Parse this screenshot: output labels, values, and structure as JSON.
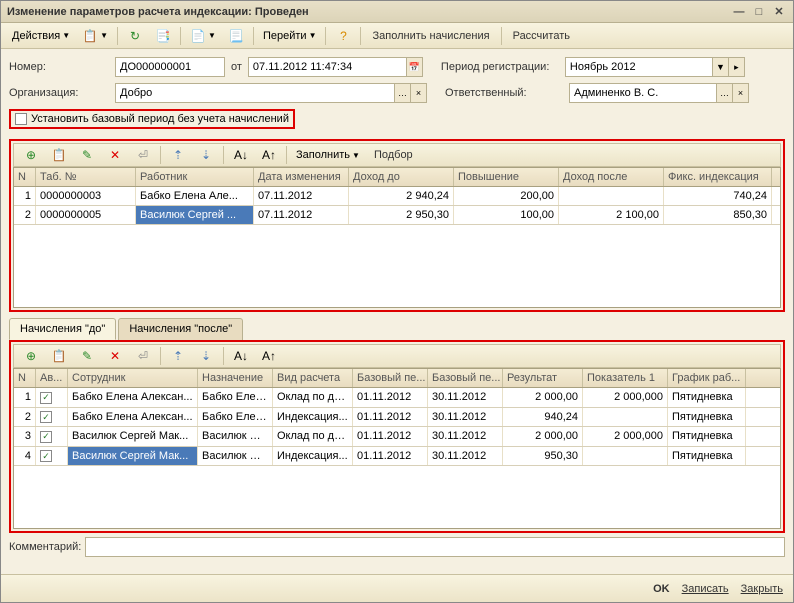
{
  "window": {
    "title": "Изменение параметров расчета индексации: Проведен"
  },
  "toolbar": {
    "actions": "Действия",
    "goto": "Перейти",
    "fill_accruals": "Заполнить начисления",
    "calculate": "Рассчитать"
  },
  "form": {
    "number_label": "Номер:",
    "number": "ДО000000001",
    "from_label": "от",
    "date": "07.11.2012 11:47:34",
    "period_label": "Период регистрации:",
    "period": "Ноябрь 2012",
    "org_label": "Организация:",
    "org": "Добро",
    "resp_label": "Ответственный:",
    "resp": "Админенко В. С.",
    "base_period": "Установить базовый период без учета начислений"
  },
  "grid1_toolbar": {
    "fill": "Заполнить",
    "select": "Подбор"
  },
  "grid1": {
    "headers": {
      "n": "N",
      "tab": "Таб. №",
      "worker": "Работник",
      "date": "Дата изменения",
      "income_before": "Доход до",
      "raise": "Повышение",
      "income_after": "Доход после",
      "fixed": "Фикс. индексация"
    },
    "rows": [
      {
        "n": "1",
        "tab": "0000000003",
        "worker": "Бабко Елена Але...",
        "date": "07.11.2012",
        "income_before": "2 940,24",
        "raise": "200,00",
        "income_after": "",
        "fixed": "740,24"
      },
      {
        "n": "2",
        "tab": "0000000005",
        "worker": "Василюк Сергей ...",
        "date": "07.11.2012",
        "income_before": "2 950,30",
        "raise": "100,00",
        "income_after": "2 100,00",
        "fixed": "850,30"
      }
    ]
  },
  "tabs": {
    "before": "Начисления \"до\"",
    "after": "Начисления \"после\""
  },
  "grid2": {
    "headers": {
      "n": "N",
      "av": "Ав...",
      "employee": "Сотрудник",
      "assign": "Назначение",
      "calc_type": "Вид расчета",
      "base_from": "Базовый пе...",
      "base_to": "Базовый пе...",
      "result": "Результат",
      "indicator": "Показатель 1",
      "schedule": "График раб..."
    },
    "rows": [
      {
        "n": "1",
        "chk": "✓",
        "employee": "Бабко Елена Алексан...",
        "assign": "Бабко Елен...",
        "calc_type": "Оклад по дн...",
        "base_from": "01.11.2012",
        "base_to": "30.11.2012",
        "result": "2 000,00",
        "indicator": "2 000,000",
        "schedule": "Пятидневка"
      },
      {
        "n": "2",
        "chk": "✓",
        "employee": "Бабко Елена Алексан...",
        "assign": "Бабко Елен...",
        "calc_type": "Индексация...",
        "base_from": "01.11.2012",
        "base_to": "30.11.2012",
        "result": "940,24",
        "indicator": "",
        "schedule": "Пятидневка"
      },
      {
        "n": "3",
        "chk": "✓",
        "employee": "Василюк Сергей Мак...",
        "assign": "Василюк Се...",
        "calc_type": "Оклад по дн...",
        "base_from": "01.11.2012",
        "base_to": "30.11.2012",
        "result": "2 000,00",
        "indicator": "2 000,000",
        "schedule": "Пятидневка"
      },
      {
        "n": "4",
        "chk": "✓",
        "employee": "Василюк Сергей Мак...",
        "assign": "Василюк Се...",
        "calc_type": "Индексация...",
        "base_from": "01.11.2012",
        "base_to": "30.11.2012",
        "result": "950,30",
        "indicator": "",
        "schedule": "Пятидневка"
      }
    ]
  },
  "comment_label": "Комментарий:",
  "footer": {
    "ok": "OK",
    "save": "Записать",
    "close": "Закрыть"
  }
}
